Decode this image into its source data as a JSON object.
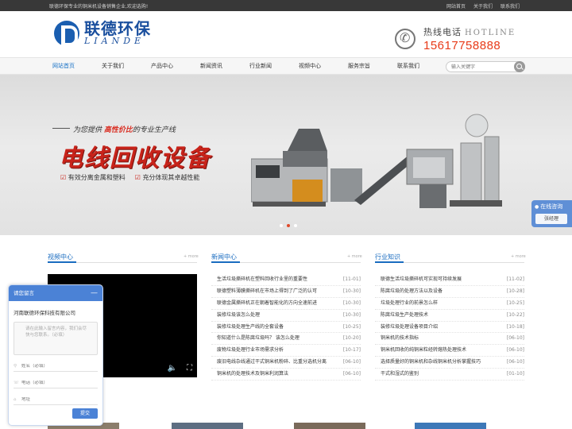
{
  "topbar": {
    "welcome": "联德环保专业的铜米机设备销售企业,欢迎选购!",
    "links": [
      "网站首页",
      "关于我们",
      "联系我们"
    ]
  },
  "header": {
    "logo_cn": "联德环保",
    "logo_en": "LIANDE",
    "hotline_label": "热线电话",
    "hotline_en": "HOTLINE",
    "hotline_number": "15617758888"
  },
  "nav": {
    "items": [
      "网站首页",
      "关于我们",
      "产品中心",
      "新闻资讯",
      "行业新闻",
      "视频中心",
      "服务宗旨",
      "联系我们"
    ],
    "active_index": 0,
    "search_placeholder": "输入关键字"
  },
  "banner": {
    "sub_prefix": "为您提供 ",
    "sub_highlight": "高性价比",
    "sub_suffix": "的专业生产线",
    "title": "电线回收设备",
    "points": [
      "有效分离金属和塑料",
      "充分体现其卓越性能"
    ],
    "accent_color": "#c8231a"
  },
  "video_center": {
    "title": "视频中心",
    "more": "+ more"
  },
  "news_center": {
    "title": "新闻中心",
    "more": "+ more",
    "items": [
      {
        "title": "生活垃圾撕碎机在塑料回收行业里的重要性",
        "date": "[11-01]"
      },
      {
        "title": "联德塑料薄膜撕碎机在市场上得到了广泛的认可",
        "date": "[10-30]"
      },
      {
        "title": "联德金属撕碎机正在朝着智能化的方向全速前进",
        "date": "[10-30]"
      },
      {
        "title": "装修垃圾该怎么处理",
        "date": "[10-30]"
      },
      {
        "title": "装修垃圾处理生产线的全套设备",
        "date": "[10-25]"
      },
      {
        "title": "你知道什么是陈腐垃圾吗？ 该怎么处理",
        "date": "[10-20]"
      },
      {
        "title": "废物垃圾处理行业市场需求分析",
        "date": "[10-17]"
      },
      {
        "title": "废旧电线杂线通过干式铜米机粉碎、比重分选机分离",
        "date": "[06-10]"
      },
      {
        "title": "铜米机的处理技术及铜米利润算法",
        "date": "[06-10]"
      }
    ]
  },
  "industry": {
    "title": "行业知识",
    "more": "+ more",
    "items": [
      {
        "title": "联德生活垃圾撕碎机可实现可持续发展",
        "date": "[11-02]"
      },
      {
        "title": "陈腐垃圾的处理方法以及设备",
        "date": "[10-28]"
      },
      {
        "title": "垃圾处理行业的前景怎么样",
        "date": "[10-25]"
      },
      {
        "title": "陈腐垃圾生产处理技术",
        "date": "[10-22]"
      },
      {
        "title": "装修垃圾处理设备项目介绍",
        "date": "[10-18]"
      },
      {
        "title": "铜米机的技术指标",
        "date": "[06-10]"
      },
      {
        "title": "铜米机回收的纯铜米粒经转熔热处理技术",
        "date": "[06-10]"
      },
      {
        "title": "选择质量好的铜米机和杂线铜米机分析掌握技巧",
        "date": "[06-10]"
      },
      {
        "title": "干式和湿式的鉴别",
        "date": "[01-10]"
      }
    ]
  },
  "consult": {
    "label": "在线咨询",
    "agent": "张经理"
  },
  "chat": {
    "header": "请您留言",
    "minimize": "—",
    "company": "河南联德环保科技有限公司",
    "message_placeholder": "请在此输入留言内容，我们会尽快与您联系。（必填）",
    "name_placeholder": "姓名（必填）",
    "phone_placeholder": "电话（必填）",
    "address_placeholder": "地址",
    "submit": "提交",
    "accent_color": "#4b82d6"
  }
}
